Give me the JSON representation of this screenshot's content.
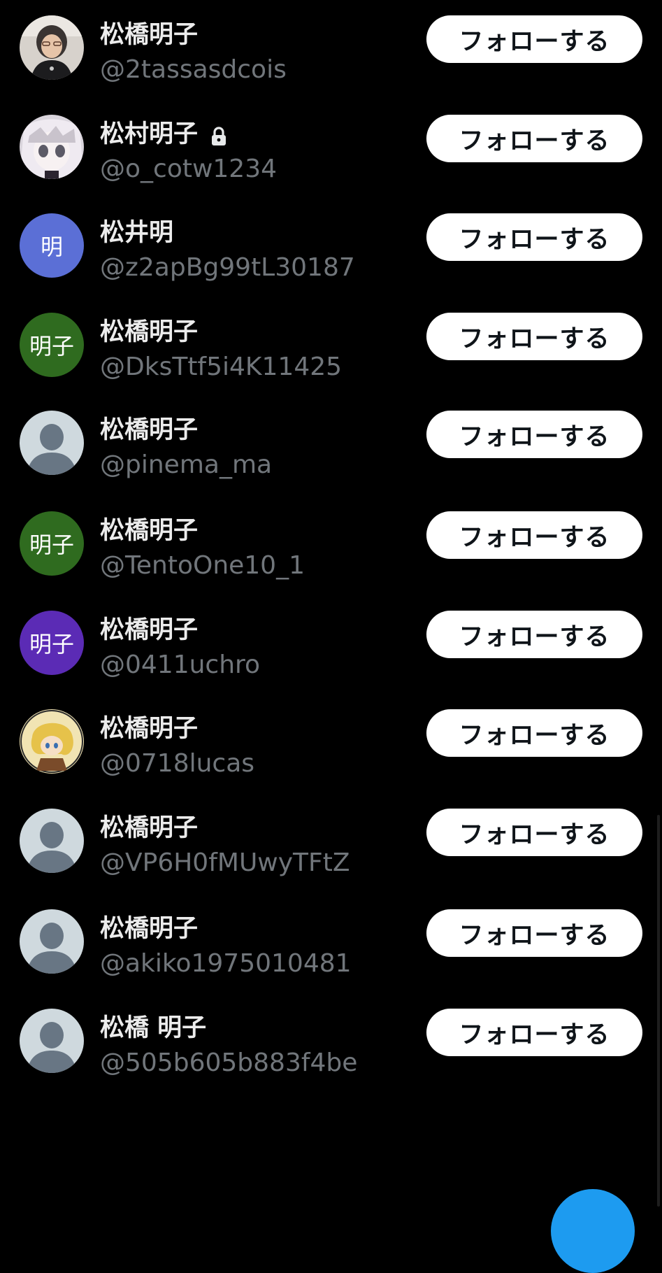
{
  "colors": {
    "background": "#000000",
    "name_text": "#ececec",
    "handle_text": "#71767b",
    "button_bg": "#ffffff",
    "button_text": "#0f1419",
    "fab_blue": "#1d9bf0"
  },
  "users": [
    {
      "name": "松橋明子",
      "handle": "@2tassasdcois",
      "avatar_type": "photo-woman",
      "follow_label": "フォローする",
      "locked": false
    },
    {
      "name": "松村明子",
      "handle": "@o_cotw1234",
      "avatar_type": "photo-anime",
      "follow_label": "フォローする",
      "locked": true
    },
    {
      "name": "松井明",
      "handle": "@z2apBg99tL30187",
      "avatar_type": "initials",
      "avatar_text": "明",
      "avatar_color": "#5b6fd6",
      "follow_label": "フォローする",
      "locked": false
    },
    {
      "name": "松橋明子",
      "handle": "@DksTtf5i4K11425",
      "avatar_type": "initials",
      "avatar_text": "明子",
      "avatar_color": "#2f6b1f",
      "follow_label": "フォローする",
      "locked": false
    },
    {
      "name": "松橋明子",
      "handle": "@pinema_ma",
      "avatar_type": "default-person",
      "follow_label": "フォローする",
      "locked": false
    },
    {
      "name": "松橋明子",
      "handle": "@TentoOne10_1",
      "avatar_type": "initials",
      "avatar_text": "明子",
      "avatar_color": "#2f6b1f",
      "follow_label": "フォローする",
      "locked": false
    },
    {
      "name": "松橋明子",
      "handle": "@0411uchro",
      "avatar_type": "initials",
      "avatar_text": "明子",
      "avatar_color": "#5b2bb5",
      "follow_label": "フォローする",
      "locked": false
    },
    {
      "name": "松橋明子",
      "handle": "@0718lucas",
      "avatar_type": "photo-anime-gold",
      "follow_label": "フォローする",
      "locked": false
    },
    {
      "name": "松橋明子",
      "handle": "@VP6H0fMUwyTFtZ",
      "avatar_type": "default-person",
      "follow_label": "フォローする",
      "locked": false
    },
    {
      "name": "松橋明子",
      "handle": "@akiko1975010481",
      "avatar_type": "default-person",
      "follow_label": "フォローする",
      "locked": false
    },
    {
      "name": "松橋 明子",
      "handle": "@505b605b883f4be",
      "avatar_type": "default-person",
      "follow_label": "フォローする",
      "locked": false
    }
  ],
  "icons": {
    "lock": "lock-icon",
    "default_avatar": "default-person-icon",
    "compose": "compose-fab-icon"
  }
}
